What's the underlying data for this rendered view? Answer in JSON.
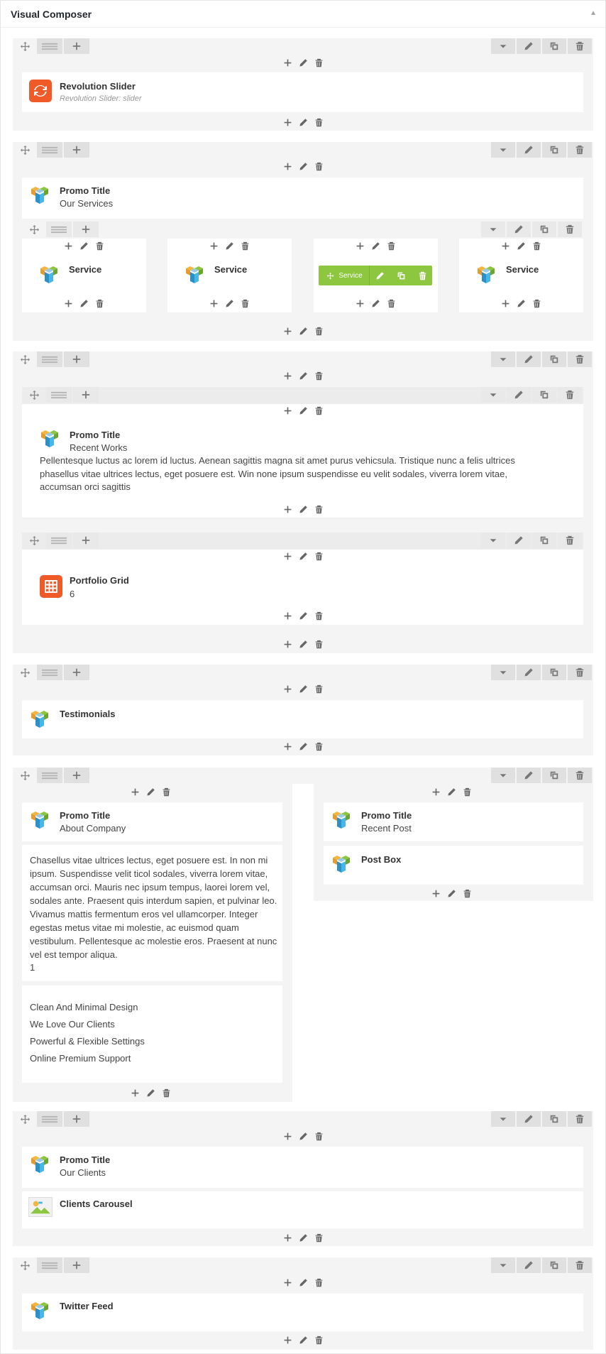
{
  "header": {
    "title": "Visual Composer",
    "toggle": "▲"
  },
  "labels": {
    "rev": "Revolution Slider",
    "rev_sub": "Revolution Slider: slider",
    "promo": "Promo Title",
    "our_services": "Our Services",
    "service": "Service",
    "recent_works": "Recent Works",
    "recent_works_text": "Pellentesque luctus ac lorem id luctus. Aenean sagittis magna sit amet purus vehicsula. Tristique nunc a felis ultrices phasellus vitae ultrices lectus, eget posuere est. Win none ipsum suspendisse eu velit sodales, viverra lorem vitae, accumsan orci sagittis",
    "portfolio": "Portfolio Grid",
    "portfolio_val": "6",
    "testimonials": "Testimonials",
    "about_company": "About Company",
    "about_text": "Chasellus vitae ultrices lectus, eget posuere est. In non mi ipsum. Suspendisse velit ticol sodales, viverra lorem vitae, accumsan orci. Mauris nec ipsum tempus, laorei lorem vel, sodales ante. Praesent quis interdum sapien, et pulvinar leo. Vivamus mattis fermentum eros vel ullamcorper. Integer egestas metus vitae mi molestie, ac euismod quam vestibulum. Pellentesque ac molestie eros. Praesent at nunc vel est tempor aliqua.",
    "about_num": "1",
    "features": [
      "Clean And Minimal Design",
      "We Love Our Clients",
      "Powerful & Flexible Settings",
      "Online Premium Support"
    ],
    "recent_post": "Recent Post",
    "post_box": "Post Box",
    "our_clients": "Our Clients",
    "clients_carousel": "Clients Carousel",
    "twitter": "Twitter Feed"
  },
  "icons": [
    "move-icon",
    "layout-icon",
    "add-icon",
    "chevron-down-icon",
    "edit-icon",
    "clone-icon",
    "delete-icon",
    "vc-logo-icon",
    "refresh-icon",
    "grid-icon",
    "image-icon"
  ],
  "colors": {
    "accent": "#8dc63f",
    "brand": "#f05a28"
  }
}
